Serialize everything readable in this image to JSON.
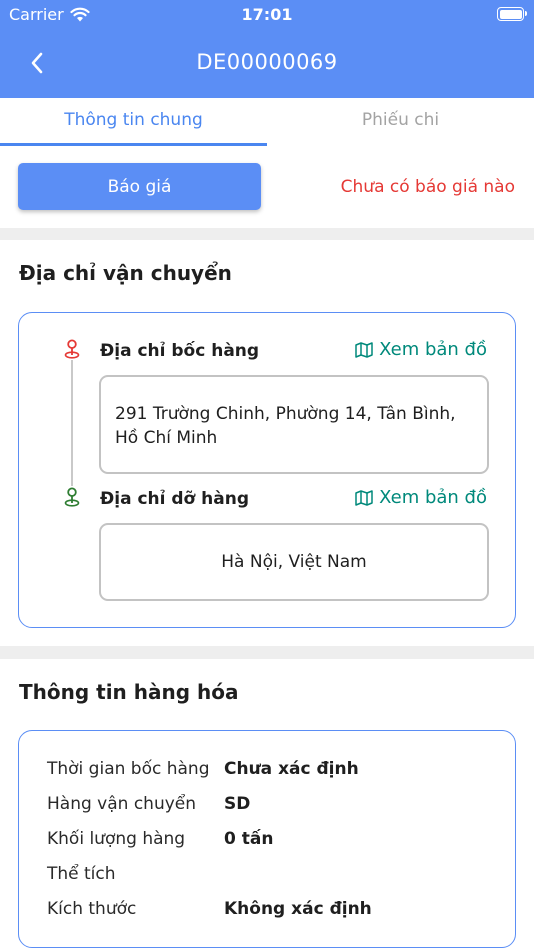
{
  "status_bar": {
    "carrier": "Carrier",
    "time": "17:01",
    "wifi_icon": "wifi-icon",
    "battery_icon": "battery-icon"
  },
  "nav": {
    "back_icon": "chevron-left-icon",
    "title": "DE00000069"
  },
  "tabs": [
    {
      "label": "Thông tin chung",
      "active": true
    },
    {
      "label": "Phiếu chi",
      "active": false
    }
  ],
  "quote": {
    "button_label": "Báo giá",
    "status_text": "Chưa có báo giá nào"
  },
  "shipping": {
    "section_title": "Địa chỉ vận chuyển",
    "pickup": {
      "label": "Địa chỉ bốc hàng",
      "map_link": "Xem bản đồ",
      "address": "291 Trường Chinh, Phường 14, Tân Bình, Hồ Chí Minh",
      "pin_color": "#e53935"
    },
    "dropoff": {
      "label": "Địa chỉ dỡ hàng",
      "map_link": "Xem bản đồ",
      "address": "Hà Nội, Việt Nam",
      "pin_color": "#2e7d32"
    }
  },
  "goods": {
    "section_title": "Thông tin hàng hóa",
    "rows": [
      {
        "key": "Thời gian bốc hàng",
        "value": "Chưa xác định"
      },
      {
        "key": "Hàng vận chuyển",
        "value": "SD"
      },
      {
        "key": "Khối lượng hàng",
        "value": "0 tấn"
      },
      {
        "key": "Thể tích",
        "value": ""
      },
      {
        "key": "Kích thước",
        "value": "Không xác định"
      }
    ]
  },
  "colors": {
    "primary": "#5b8ef5",
    "tab_active": "#4a86f0",
    "alert": "#e53935",
    "link": "#00897b"
  }
}
